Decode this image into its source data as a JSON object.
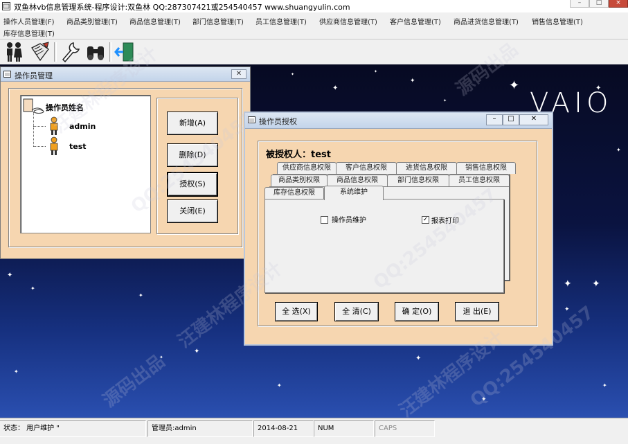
{
  "app": {
    "title": "双鱼林vb信息管理系统-程序设计:双鱼林 QQ:287307421或254540457 www.shuangyulin.com"
  },
  "menu": [
    "操作人员管理(F)",
    "商品类别管理(T)",
    "商品信息管理(T)",
    "部门信息管理(T)",
    "员工信息管理(T)",
    "供应商信息管理(T)",
    "客户信息管理(T)",
    "商品进货信息管理(T)",
    "销售信息管理(T)",
    "库存信息管理(T)"
  ],
  "toolbar": {
    "icons": [
      "users-icon",
      "edit-icon",
      "wrench-icon",
      "binoculars-icon",
      "exit-icon"
    ]
  },
  "desktop": {
    "logo": "VAIO"
  },
  "operator_window": {
    "title": "操作员管理",
    "tree_root": "操作员姓名",
    "users": [
      "admin",
      "test"
    ],
    "buttons": {
      "add": "新增(A)",
      "delete": "删除(D)",
      "authorize": "授权(S)",
      "close": "关闭(E)"
    }
  },
  "auth_window": {
    "title": "操作员授权",
    "grantee_label": "被授权人：",
    "grantee": "test",
    "tabs_row1": [
      "供应商信息权限",
      "客户信息权限",
      "进货信息权限",
      "销售信息权限"
    ],
    "tabs_row2": [
      "商品类别权限",
      "商品信息权限",
      "部门信息权限",
      "员工信息权限"
    ],
    "tabs_row3": [
      "库存信息权限",
      "系统维护"
    ],
    "active_tab": "系统维护",
    "checks": [
      {
        "label": "操作员维护",
        "checked": false
      },
      {
        "label": "报表打印",
        "checked": true
      }
    ],
    "check_marks": {
      "unchecked": "",
      "checked": "✓"
    },
    "buttons": {
      "select_all": "全 选(X)",
      "clear_all": "全 清(C)",
      "ok": "确 定(O)",
      "exit": "退 出(E)"
    }
  },
  "status": {
    "state": "状态： 用户维护 \"",
    "admin": "管理员:admin",
    "date": "2014-08-21",
    "num": "NUM",
    "caps": "CAPS"
  },
  "watermarks": [
    "汪建林程序设计",
    "QQ:254540457",
    "源码出品",
    "QQ:254540457",
    "汪建林程序设计",
    "QQ:254540457",
    "源码出品",
    "汪建林程序设计"
  ],
  "colors": {
    "form_bg": "#f6d6b0",
    "desktop_top": "#070a22",
    "desktop_bottom": "#2a4fb0"
  }
}
